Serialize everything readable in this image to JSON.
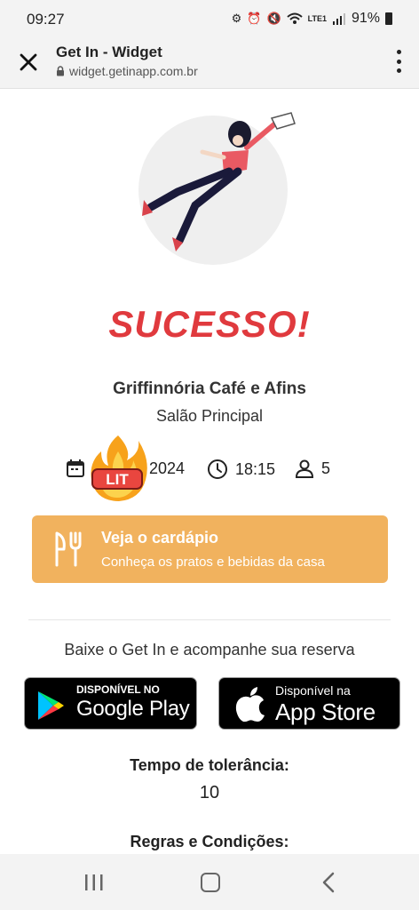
{
  "status_bar": {
    "time": "09:27",
    "lte_label": "LTE1",
    "battery_percent": "91%"
  },
  "browser": {
    "title": "Get In - Widget",
    "url": "widget.getinapp.com.br"
  },
  "reservation": {
    "success_title": "SUCESSO!",
    "restaurant_name": "Griffinnória Café e Afins",
    "area": "Salão Principal",
    "date_visible": "2024",
    "time": "18:15",
    "guests": "5",
    "sticker_text": "LIT"
  },
  "menu_card": {
    "title": "Veja o cardápio",
    "subtitle": "Conheça os pratos e bebidas da casa"
  },
  "download": {
    "text": "Baixe o Get In e acompanhe sua reserva",
    "google_play_small": "DISPONÍVEL NO",
    "google_play_big": "Google Play",
    "app_store_small": "Disponível na",
    "app_store_big": "App Store"
  },
  "tolerance": {
    "label": "Tempo de tolerância:",
    "value": "10"
  },
  "rules_label": "Regras e Condições:",
  "colors": {
    "accent_red": "#e03a3e",
    "menu_card": "#f1b25e"
  }
}
